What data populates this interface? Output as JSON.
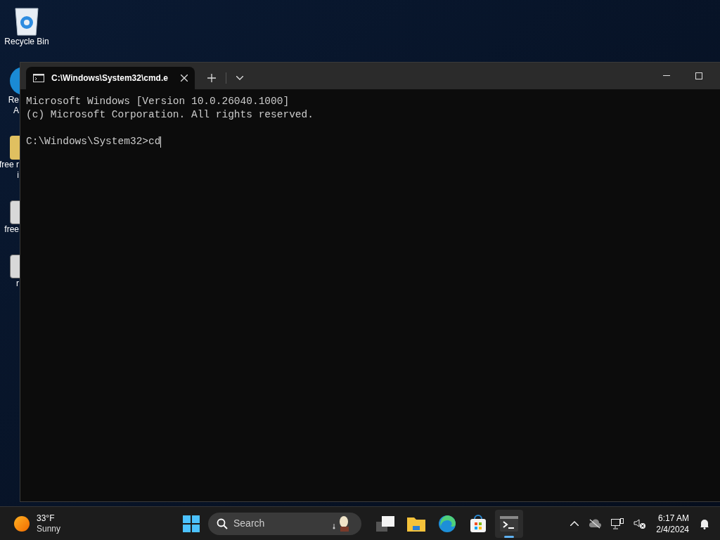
{
  "desktop_icons": [
    {
      "kind": "recycle",
      "label_lines": [
        "Recycle Bin"
      ]
    },
    {
      "kind": "edge",
      "label_lines": [
        "Re",
        "A"
      ]
    },
    {
      "kind": "folder",
      "label_lines": [
        "free r",
        "i"
      ]
    },
    {
      "kind": "file",
      "label_lines": [
        "free"
      ]
    },
    {
      "kind": "file",
      "label_lines": [
        "r"
      ]
    }
  ],
  "window": {
    "tab": {
      "title": "C:\\Windows\\System32\\cmd.e",
      "selected": true
    },
    "lines": [
      "Microsoft Windows [Version 10.0.26040.1000]",
      "(c) Microsoft Corporation. All rights reserved."
    ],
    "prompt": "C:\\Windows\\System32>cd"
  },
  "taskbar": {
    "weather": {
      "temperature": "33°F",
      "condition": "Sunny"
    },
    "search": {
      "placeholder": "Search"
    },
    "apps": [
      {
        "kind": "taskview",
        "active": false
      },
      {
        "kind": "explorer",
        "active": false
      },
      {
        "kind": "edge",
        "active": false
      },
      {
        "kind": "store",
        "active": false
      },
      {
        "kind": "terminal",
        "active": true
      }
    ],
    "clock": {
      "time": "6:17 AM",
      "date": "2/4/2024"
    }
  }
}
